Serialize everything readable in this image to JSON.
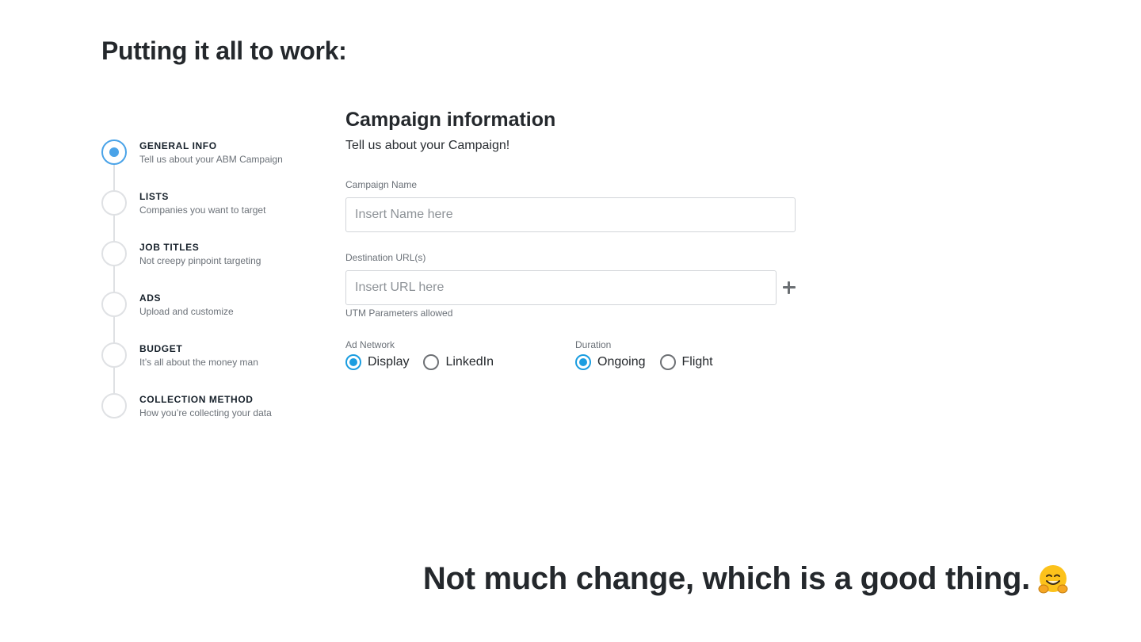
{
  "slide": {
    "heading": "Putting it all to work:",
    "footer": "Not much change, which is a good thing.",
    "footer_emoji": "hugging-face"
  },
  "stepper": {
    "steps": [
      {
        "title": "GENERAL INFO",
        "subtitle": "Tell us about your ABM Campaign",
        "active": true
      },
      {
        "title": "LISTS",
        "subtitle": "Companies you want to target",
        "active": false
      },
      {
        "title": "JOB TITLES",
        "subtitle": "Not creepy pinpoint targeting",
        "active": false
      },
      {
        "title": "ADS",
        "subtitle": "Upload and customize",
        "active": false
      },
      {
        "title": "BUDGET",
        "subtitle": "It’s all about the money man",
        "active": false
      },
      {
        "title": "COLLECTION METHOD",
        "subtitle": "How you’re collecting your data",
        "active": false
      }
    ]
  },
  "form": {
    "title": "Campaign information",
    "subtitle": "Tell us about your Campaign!",
    "campaign_name": {
      "label": "Campaign Name",
      "placeholder": "Insert Name here",
      "value": ""
    },
    "destination_url": {
      "label": "Destination URL(s)",
      "placeholder": "Insert URL here",
      "value": "",
      "hint": "UTM Parameters allowed",
      "add_icon": "plus-icon"
    },
    "ad_network": {
      "label": "Ad Network",
      "options": [
        {
          "label": "Display",
          "checked": true
        },
        {
          "label": "LinkedIn",
          "checked": false
        }
      ]
    },
    "duration": {
      "label": "Duration",
      "options": [
        {
          "label": "Ongoing",
          "checked": true
        },
        {
          "label": "Flight",
          "checked": false
        }
      ]
    }
  },
  "colors": {
    "accent": "#1a9de0",
    "step_active": "#4aa3e8",
    "text": "#24282c",
    "muted": "#6b7178"
  }
}
